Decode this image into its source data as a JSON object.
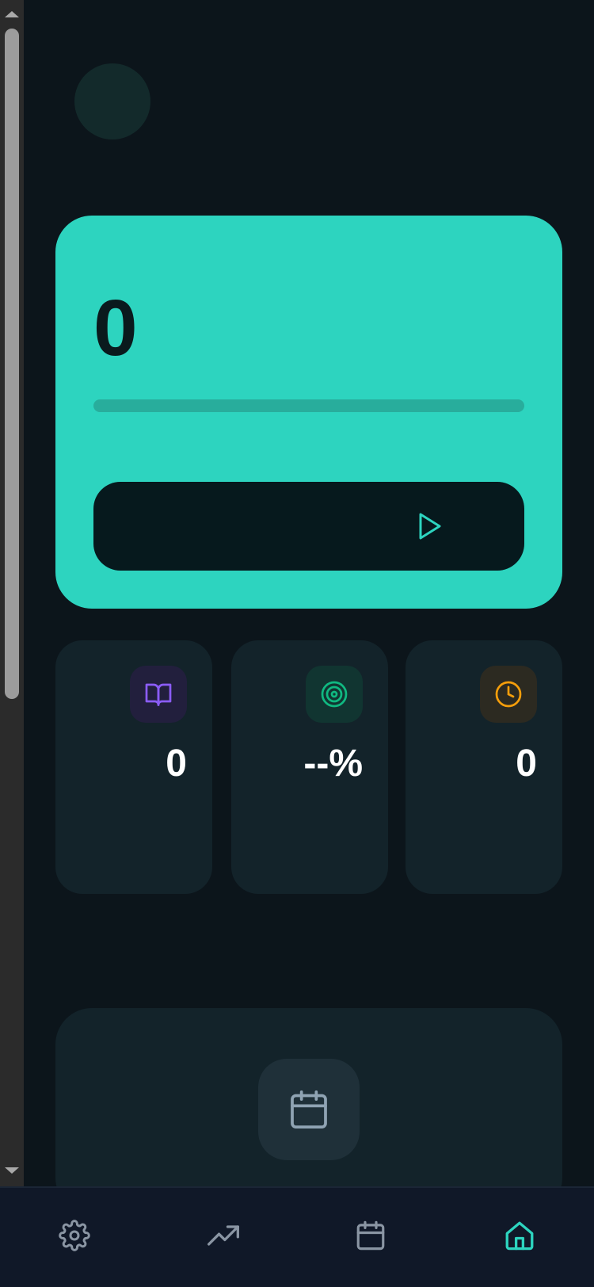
{
  "hero": {
    "count": "0",
    "progress_fraction": 0
  },
  "stats": [
    {
      "icon": "book-icon",
      "value": "0",
      "accent": "#8b5cf6"
    },
    {
      "icon": "target-icon",
      "value": "--%",
      "accent": "#10b981"
    },
    {
      "icon": "clock-icon",
      "value": "0",
      "accent": "#f59e0b"
    }
  ],
  "nav": [
    {
      "icon": "gear-icon",
      "active": false
    },
    {
      "icon": "trending-up-icon",
      "active": false
    },
    {
      "icon": "calendar-icon",
      "active": false
    },
    {
      "icon": "home-icon",
      "active": true
    }
  ],
  "colors": {
    "accent": "#2dd4bf",
    "background": "#0c151b",
    "card": "#13232a",
    "nav_inactive": "#8a95a3"
  }
}
